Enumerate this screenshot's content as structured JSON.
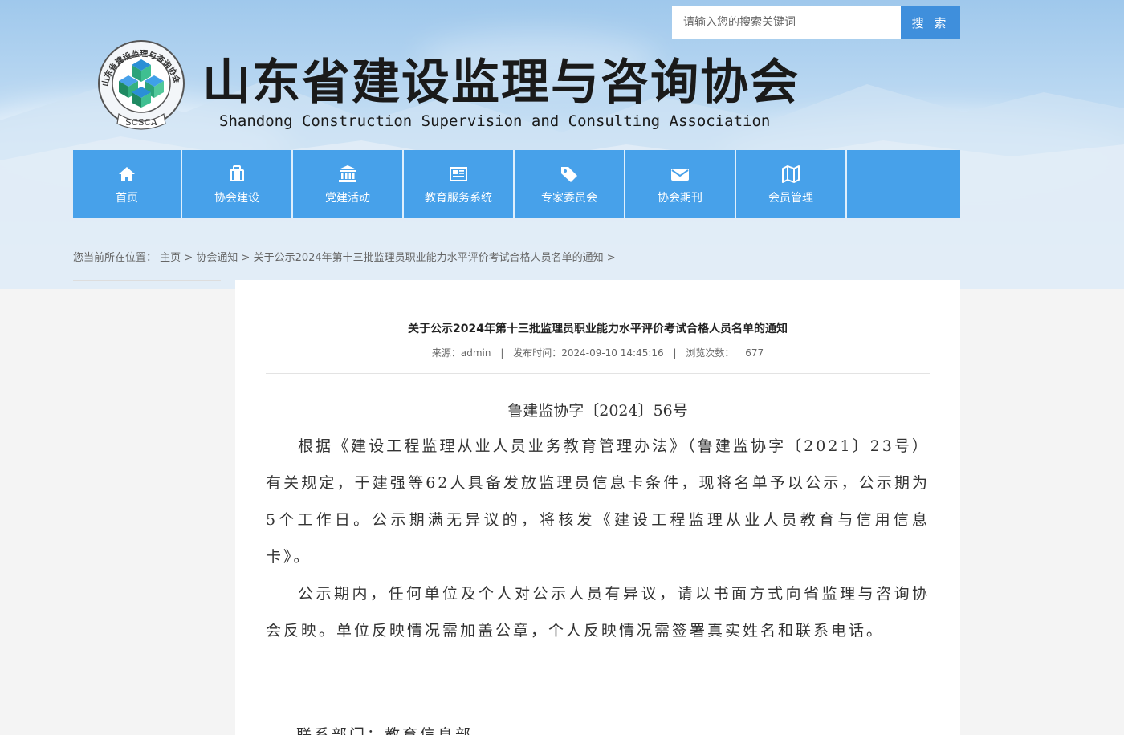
{
  "search": {
    "placeholder": "请输入您的搜索关键词",
    "button_label": "搜 索"
  },
  "header": {
    "title": "山东省建设监理与咨询协会",
    "subtitle": "Shandong Construction Supervision and Consulting Association",
    "logo_text": "山东省建设监理与咨询协会",
    "logo_abbr": "SCSCA"
  },
  "nav": {
    "items": [
      {
        "label": "首页",
        "icon": "home-icon"
      },
      {
        "label": "协会建设",
        "icon": "briefcase-icon"
      },
      {
        "label": "党建活动",
        "icon": "institution-icon"
      },
      {
        "label": "教育服务系统",
        "icon": "newspaper-icon"
      },
      {
        "label": "专家委员会",
        "icon": "tags-icon"
      },
      {
        "label": "协会期刊",
        "icon": "envelope-icon"
      },
      {
        "label": "会员管理",
        "icon": "map-icon"
      }
    ]
  },
  "breadcrumb": {
    "prefix": "您当前所在位置：",
    "home": "主页",
    "category": "协会通知",
    "current": "关于公示2024年第十三批监理员职业能力水平评价考试合格人员名单的通知",
    "sep": ">"
  },
  "article": {
    "title": "关于公示2024年第十三批监理员职业能力水平评价考试合格人员名单的通知",
    "meta": {
      "source": "来源：admin",
      "published": "发布时间：2024-09-10 14:45:16",
      "views_label": "浏览次数：",
      "views": "677"
    },
    "doc_number": "鲁建监协字〔2024〕56号",
    "paragraphs": [
      "根据《建设工程监理从业人员业务教育管理办法》（鲁建监协字〔2021〕23号）有关规定，于建强等62人具备发放监理员信息卡条件，现将名单予以公示，公示期为5个工作日。公示期满无异议的，将核发《建设工程监理从业人员教育与信用信息卡》。",
      "公示期内，任何单位及个人对公示人员有异议，请以书面方式向省监理与咨询协会反映。单位反映情况需加盖公章，个人反映情况需签署真实姓名和联系电话。"
    ],
    "contact": "联系部门：教育信息部"
  },
  "colors": {
    "nav_bg": "#47a1ea",
    "search_btn": "#3f8fdc"
  }
}
